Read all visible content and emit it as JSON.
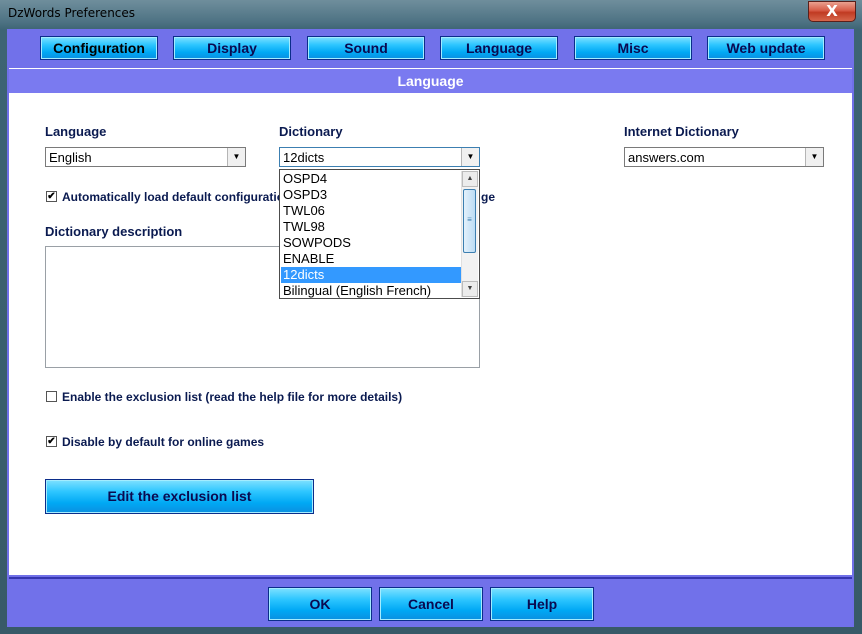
{
  "window": {
    "title": "DzWords Preferences",
    "close_glyph": "X"
  },
  "tabs": [
    {
      "label": "Configuration",
      "active": true
    },
    {
      "label": "Display"
    },
    {
      "label": "Sound"
    },
    {
      "label": "Language"
    },
    {
      "label": "Misc"
    },
    {
      "label": "Web update"
    }
  ],
  "section_title": "Language",
  "language": {
    "label": "Language",
    "value": "English"
  },
  "dictionary": {
    "label": "Dictionary",
    "value": "12dicts",
    "options": [
      "OSPD4",
      "OSPD3",
      "TWL06",
      "TWL98",
      "SOWPODS",
      "ENABLE",
      "12dicts",
      "Bilingual (English French)"
    ],
    "selected_index": 6
  },
  "internet_dictionary": {
    "label": "Internet Dictionary",
    "value": "answers.com"
  },
  "auto_load": {
    "label_left": "Automatically load default configuratio",
    "label_right": "ge",
    "checked": true,
    "check_glyph": "✔"
  },
  "dictionary_description": {
    "label": "Dictionary description",
    "value": ""
  },
  "exclusion_list": {
    "label": "Enable the exclusion list (read the help file for more details)",
    "checked": false
  },
  "disable_online": {
    "label": "Disable by default for online games",
    "checked": true,
    "check_glyph": "✔"
  },
  "edit_exclusion_label": "Edit the exclusion list",
  "footer": {
    "ok": "OK",
    "cancel": "Cancel",
    "help": "Help"
  },
  "icons": {
    "dropdown_arrow": "▼",
    "scroll_up": "▲",
    "scroll_down": "▼",
    "thumb_grip": "≡"
  }
}
